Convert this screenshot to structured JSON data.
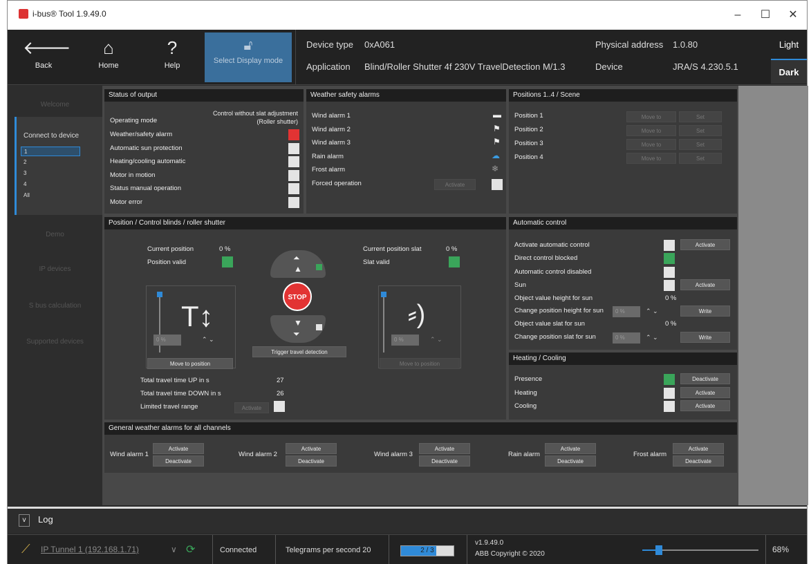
{
  "window": {
    "title": "i-bus® Tool 1.9.49.0",
    "minimize": "–",
    "maximize": "☐",
    "close": "✕"
  },
  "toolbar": {
    "back": "Back",
    "home": "Home",
    "help": "Help",
    "select_display_mode": "Select Display mode",
    "device_type_label": "Device type",
    "device_type_value": "0xA061",
    "application_label": "Application",
    "application_value": "Blind/Roller Shutter 4f 230V TravelDetection M/1.3",
    "physical_address_label": "Physical address",
    "physical_address_value": "1.0.80",
    "device_label": "Device",
    "device_value": "JRA/S 4.230.5.1",
    "light": "Light",
    "dark": "Dark"
  },
  "sidebar": {
    "welcome": "Welcome",
    "connect": "Connect to device",
    "channels": [
      "1",
      "2",
      "3",
      "4",
      "All"
    ],
    "demo": "Demo",
    "ip_devices": "IP devices",
    "sbus": "S bus calculation",
    "supported": "Supported devices"
  },
  "status_output": {
    "title": "Status of output",
    "operating_mode_label": "Operating mode",
    "operating_mode_value_1": "Control without slat adjustment",
    "operating_mode_value_2": "(Roller shutter)",
    "rows": [
      "Weather/safety alarm",
      "Automatic sun protection",
      "Heating/cooling automatic",
      "Motor in motion",
      "Status manual operation",
      "Motor error"
    ]
  },
  "weather": {
    "title": "Weather safety alarms",
    "rows": [
      "Wind alarm 1",
      "Wind alarm 2",
      "Wind alarm 3",
      "Rain alarm",
      "Frost alarm",
      "Forced operation"
    ],
    "activate": "Activate"
  },
  "positions": {
    "title": "Positions 1..4 / Scene",
    "rows": [
      "Position 1",
      "Position 2",
      "Position 3",
      "Position 4"
    ],
    "move_to": "Move to",
    "set": "Set"
  },
  "control": {
    "title": "Position / Control blinds / roller shutter",
    "current_position": "Current position",
    "current_position_value": "0 %",
    "position_valid": "Position valid",
    "current_slat": "Current position slat",
    "current_slat_value": "0 %",
    "slat_valid": "Slat valid",
    "input_value": "0 %",
    "move_to_position": "Move to position",
    "stop": "STOP",
    "trigger": "Trigger travel detection",
    "total_up": "Total travel time UP in s",
    "total_up_value": "27",
    "total_down": "Total travel time DOWN in s",
    "total_down_value": "26",
    "limited": "Limited travel range",
    "activate": "Activate"
  },
  "automatic": {
    "title": "Automatic control",
    "activate_auto": "Activate automatic control",
    "direct_blocked": "Direct control blocked",
    "auto_disabled": "Automatic control disabled",
    "sun": "Sun",
    "obj_height": "Object value height for sun",
    "obj_height_value": "0 %",
    "chg_height": "Change position height for sun",
    "obj_slat": "Object value slat for sun",
    "obj_slat_value": "0 %",
    "chg_slat": "Change position slat for sun",
    "input_value": "0 %",
    "activate": "Activate",
    "write": "Write"
  },
  "heating": {
    "title": "Heating / Cooling",
    "presence": "Presence",
    "heating": "Heating",
    "cooling": "Cooling",
    "deactivate": "Deactivate",
    "activate": "Activate"
  },
  "general": {
    "title": "General weather alarms for all channels",
    "alarms": [
      "Wind alarm 1",
      "Wind alarm 2",
      "Wind alarm 3",
      "Rain alarm",
      "Frost alarm"
    ],
    "activate": "Activate",
    "deactivate": "Deactivate"
  },
  "log": {
    "toggle": "v",
    "label": "Log"
  },
  "status": {
    "tunnel": "IP Tunnel 1 (192.168.1.71)",
    "connected": "Connected",
    "telegrams": "Telegrams per second 20",
    "progress": "2 / 3",
    "progress_fraction": 0.67,
    "version": "v1.9.49.0",
    "copyright": "ABB Copyright © 2020",
    "zoom": "68%",
    "zoom_level": 0.68
  }
}
